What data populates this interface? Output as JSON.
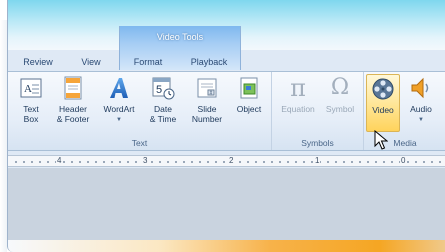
{
  "ribbon": {
    "context_tab_group": "Video Tools",
    "tabs": [
      {
        "label": "Review"
      },
      {
        "label": "View"
      },
      {
        "label": "Format"
      },
      {
        "label": "Playback"
      }
    ],
    "groups": {
      "text": {
        "label": "Text",
        "buttons": [
          {
            "line1": "Text",
            "line2": "Box",
            "icon": "text-box-icon"
          },
          {
            "line1": "Header",
            "line2": "& Footer",
            "icon": "header-footer-icon"
          },
          {
            "line1": "WordArt",
            "line2": "",
            "icon": "wordart-icon"
          },
          {
            "line1": "Date",
            "line2": "& Time",
            "icon": "date-time-icon"
          },
          {
            "line1": "Slide",
            "line2": "Number",
            "icon": "slide-number-icon"
          },
          {
            "line1": "Object",
            "line2": "",
            "icon": "object-icon"
          }
        ]
      },
      "symbols": {
        "label": "Symbols",
        "buttons": [
          {
            "line1": "Equation",
            "icon": "pi-icon"
          },
          {
            "line1": "Symbol",
            "icon": "omega-icon"
          }
        ]
      },
      "media": {
        "label": "Media",
        "buttons": [
          {
            "line1": "Video",
            "icon": "film-reel-icon"
          },
          {
            "line1": "Audio",
            "icon": "speaker-icon"
          }
        ]
      }
    }
  },
  "ruler": {
    "marks": [
      "4",
      "3",
      "2",
      "1",
      "0"
    ]
  }
}
